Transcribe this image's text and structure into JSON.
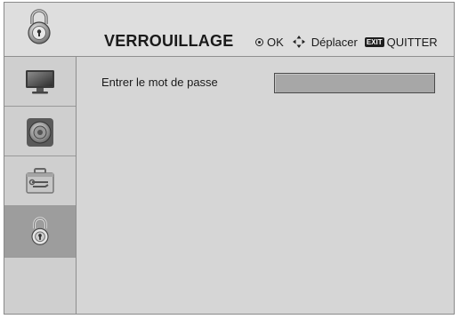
{
  "header": {
    "title": "VERROUILLAGE",
    "icon": "padlock-icon",
    "hints": {
      "ok_label": "OK",
      "move_label": "Déplacer",
      "exit_badge": "EXIT",
      "exit_label": "QUITTER"
    }
  },
  "sidebar": {
    "items": [
      {
        "icon": "tv-icon",
        "active": false
      },
      {
        "icon": "speaker-icon",
        "active": false
      },
      {
        "icon": "toolbox-icon",
        "active": false
      },
      {
        "icon": "padlock-icon",
        "active": true
      }
    ]
  },
  "main": {
    "password_label": "Entrer le mot de passe",
    "password_value": ""
  },
  "colors": {
    "panel_bg": "#d6d6d6",
    "sidebar_active": "#9d9d9d",
    "field_bg": "#a7a7a7"
  }
}
